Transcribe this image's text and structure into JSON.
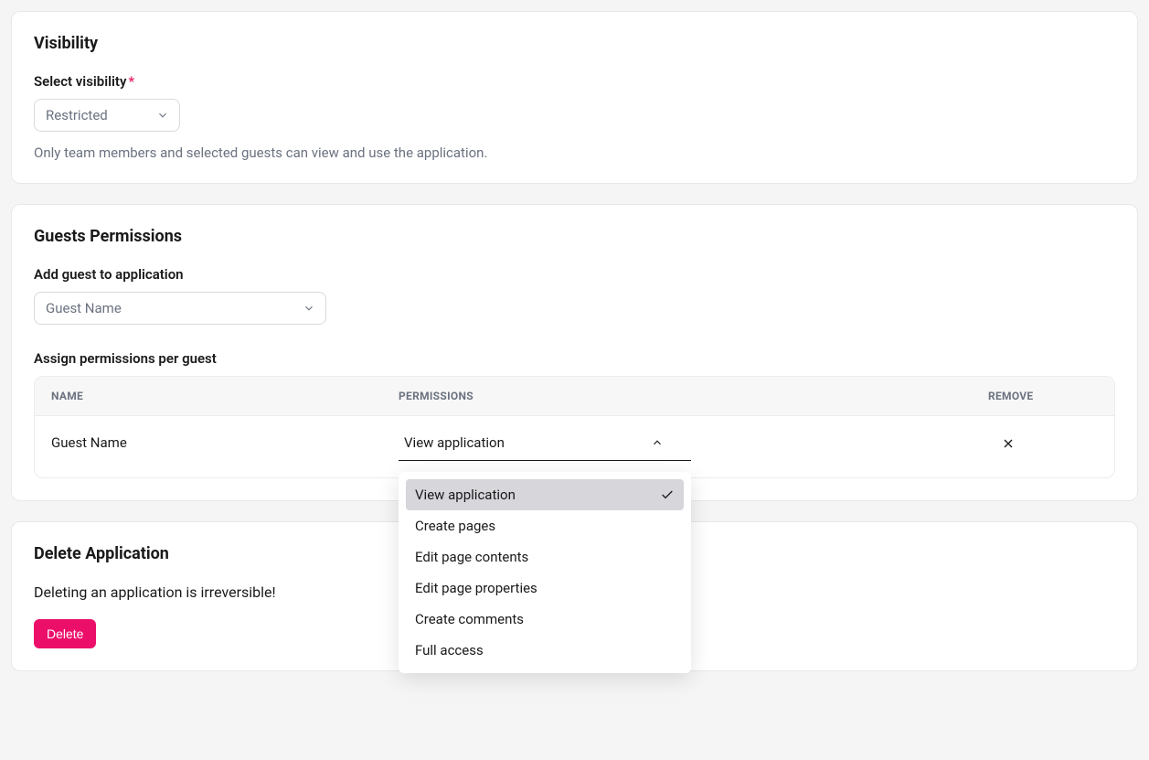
{
  "visibility": {
    "title": "Visibility",
    "select_label": "Select visibility",
    "selected": "Restricted",
    "help": "Only team members and selected guests can view and use the application."
  },
  "guests": {
    "title": "Guests Permissions",
    "add_label": "Add guest to application",
    "add_placeholder": "Guest Name",
    "assign_label": "Assign permissions per guest",
    "columns": {
      "name": "NAME",
      "permissions": "PERMISSIONS",
      "remove": "REMOVE"
    },
    "row": {
      "name": "Guest Name",
      "selected_permission": "View application"
    },
    "permission_options": [
      "View application",
      "Create pages",
      "Edit page contents",
      "Edit page properties",
      "Create comments",
      "Full access"
    ]
  },
  "delete": {
    "title": "Delete Application",
    "warning": "Deleting an application is irreversible!",
    "button": "Delete"
  }
}
